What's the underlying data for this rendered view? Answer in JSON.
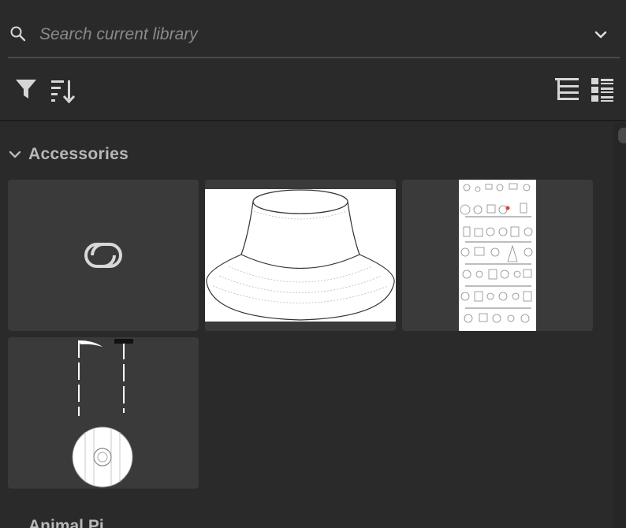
{
  "search": {
    "placeholder": "Search current library",
    "value": ""
  },
  "toolbar": {
    "left_icons": [
      "filter-icon",
      "sort-icon"
    ],
    "right_icons": [
      "grid-view-icon",
      "list-view-icon"
    ]
  },
  "groups": [
    {
      "title": "Accessories",
      "expanded": true,
      "items": [
        {
          "kind": "cloud-placeholder",
          "icon": "creative-cloud-icon"
        },
        {
          "kind": "image",
          "subject": "bucket hat sketch"
        },
        {
          "kind": "image",
          "subject": "accessories reference sheet"
        },
        {
          "kind": "image",
          "subject": "scythe, staff and round shield sketch"
        }
      ]
    },
    {
      "title": "Animal Pi",
      "expanded": false
    }
  ],
  "colors": {
    "panel_bg": "#2a2a2a",
    "tile_bg": "#3a3a3a",
    "text": "#b8b8b8",
    "placeholder": "#8a8a8a",
    "icon": "#d6d6d6"
  }
}
